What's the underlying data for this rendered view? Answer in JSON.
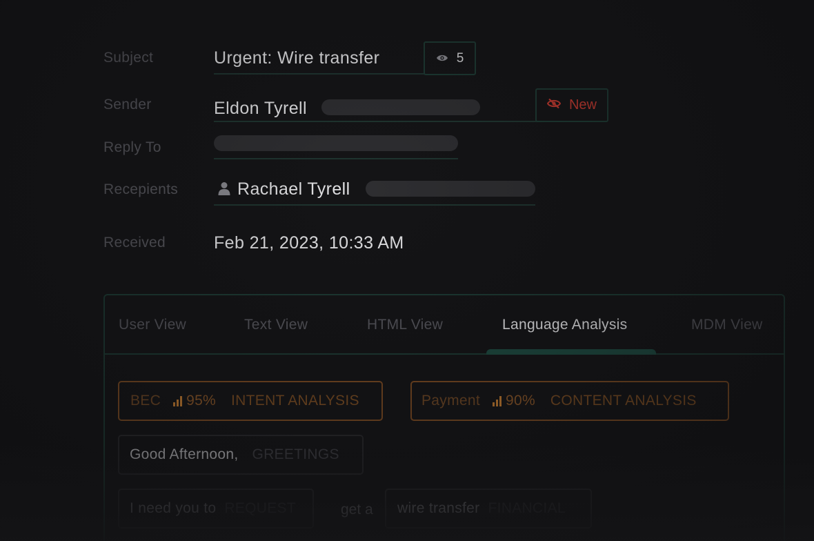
{
  "fields": {
    "subject": {
      "label": "Subject",
      "value": "Urgent: Wire transfer",
      "views_count": "5"
    },
    "sender": {
      "label": "Sender",
      "name": "Eldon Tyrell",
      "badge": "New"
    },
    "reply_to": {
      "label": "Reply To"
    },
    "recipients": {
      "label": "Recepients",
      "name": "Rachael Tyrell"
    },
    "received": {
      "label": "Received",
      "value": "Feb 21, 2023, 10:33 AM"
    }
  },
  "tabs": [
    {
      "label": "User View",
      "active": false
    },
    {
      "label": "Text View",
      "active": false
    },
    {
      "label": "HTML View",
      "active": false
    },
    {
      "label": "Language Analysis",
      "active": true
    },
    {
      "label": "MDM View",
      "active": false
    }
  ],
  "analysis": {
    "intent": {
      "word": "BEC",
      "percent": "95%",
      "category": "INTENT ANALYSIS"
    },
    "content": {
      "word": "Payment",
      "percent": "90%",
      "category": "CONTENT ANALYSIS"
    },
    "greeting": {
      "text": "Good Afternoon,",
      "category": "GREETINGS"
    },
    "request": {
      "text": "I need you to",
      "category": "REQUEST"
    },
    "connector": {
      "text": "get a"
    },
    "financial": {
      "text": "wire transfer",
      "category": "FINANCIAL"
    }
  },
  "colors": {
    "accent_teal": "#1d3a33",
    "warning_red": "#c2392f",
    "analysis_orange": "#c07a30"
  },
  "icons": {
    "views": "eye-icon",
    "new_badge": "eye-off-icon",
    "recipient": "user-icon",
    "score": "signal-bars-icon"
  }
}
